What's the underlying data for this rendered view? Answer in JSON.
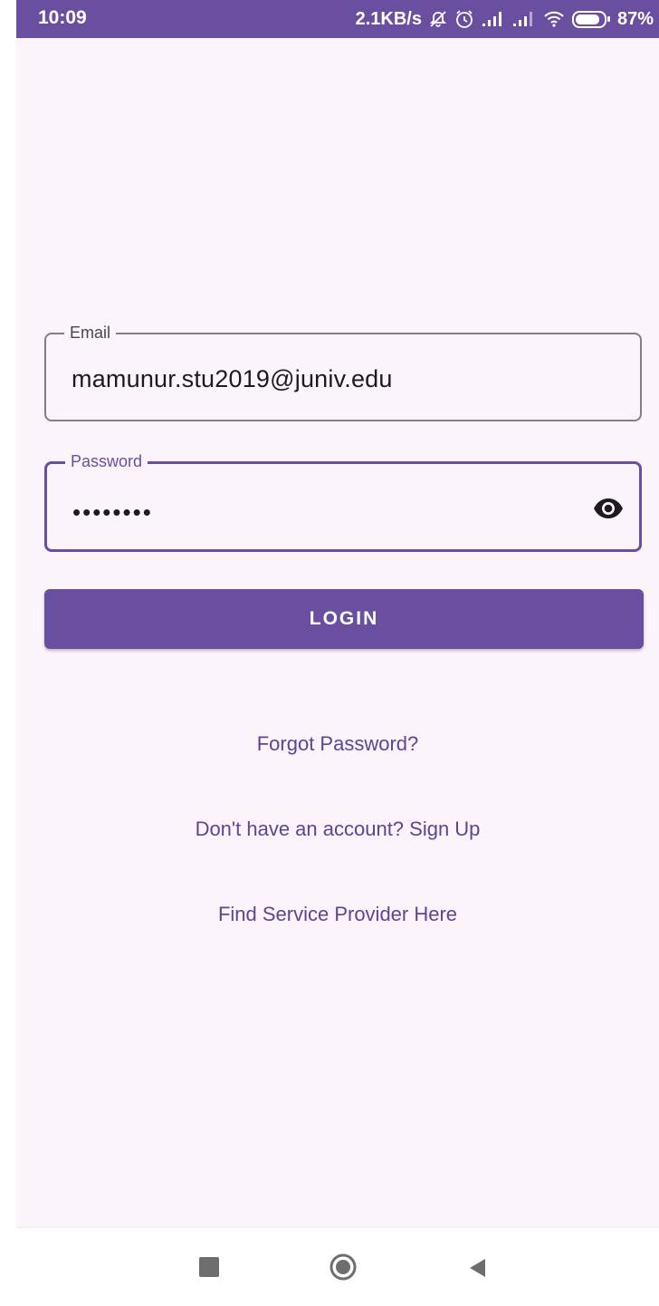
{
  "status_bar": {
    "time": "10:09",
    "network_speed": "2.1KB/s",
    "battery_percent": "87%",
    "icons": [
      "bell-off-icon",
      "alarm-icon",
      "signal-icon",
      "signal-icon",
      "wifi-icon",
      "battery-icon"
    ]
  },
  "form": {
    "email": {
      "label": "Email",
      "value": "mamunur.stu2019@juniv.edu"
    },
    "password": {
      "label": "Password",
      "value": "••••••••",
      "toggle_icon": "eye-icon"
    }
  },
  "buttons": {
    "login_label": "LOGIN"
  },
  "links": {
    "forgot_password": "Forgot Password?",
    "sign_up": "Don't have an account? Sign Up",
    "find_service_provider": "Find Service Provider Here"
  },
  "nav_bar": {
    "icons": [
      "recents-square-icon",
      "home-circle-icon",
      "back-triangle-icon"
    ]
  },
  "colors": {
    "primary": "#6a4fa1",
    "background": "#fcf4fb",
    "link": "#5d4494",
    "outline": "#857c8a"
  }
}
